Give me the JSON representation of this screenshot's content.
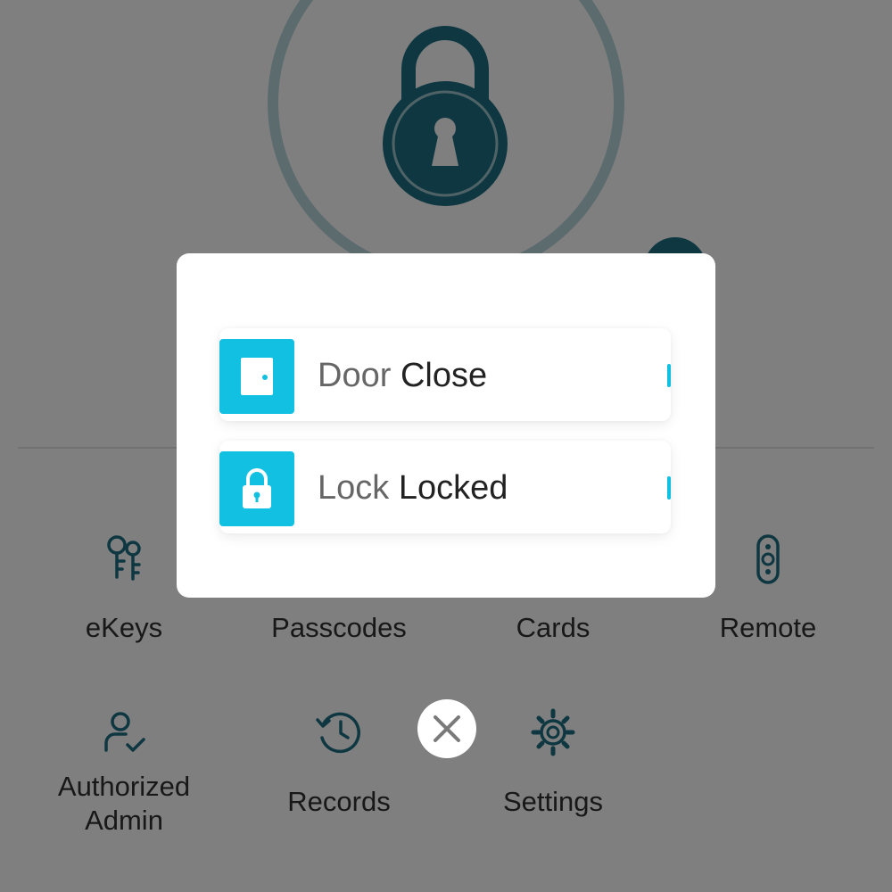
{
  "colors": {
    "accent": "#12c0e2",
    "primary": "#1c6f82",
    "ring": "#b9d6da",
    "overlay": "rgba(0,0,0,0.5)"
  },
  "lock_screen": {
    "lock_icon": "padlock-keyhole-icon",
    "unlock_button_icon": "unlock-button-icon"
  },
  "features": [
    {
      "label": "eKeys",
      "icon": "ekeys-icon"
    },
    {
      "label": "Passcodes",
      "icon": "passcodes-icon"
    },
    {
      "label": "Cards",
      "icon": "cards-icon"
    },
    {
      "label": "Remote",
      "icon": "remote-icon"
    },
    {
      "label": "Authorized Admin",
      "icon": "authorized-admin-icon"
    },
    {
      "label": "Records",
      "icon": "records-icon"
    },
    {
      "label": "Settings",
      "icon": "settings-icon"
    }
  ],
  "status_dialog": {
    "rows": [
      {
        "name": "Door",
        "value": "Close",
        "icon": "door-icon"
      },
      {
        "name": "Lock",
        "value": "Locked",
        "icon": "padlock-icon"
      }
    ],
    "close_icon": "close-icon"
  }
}
